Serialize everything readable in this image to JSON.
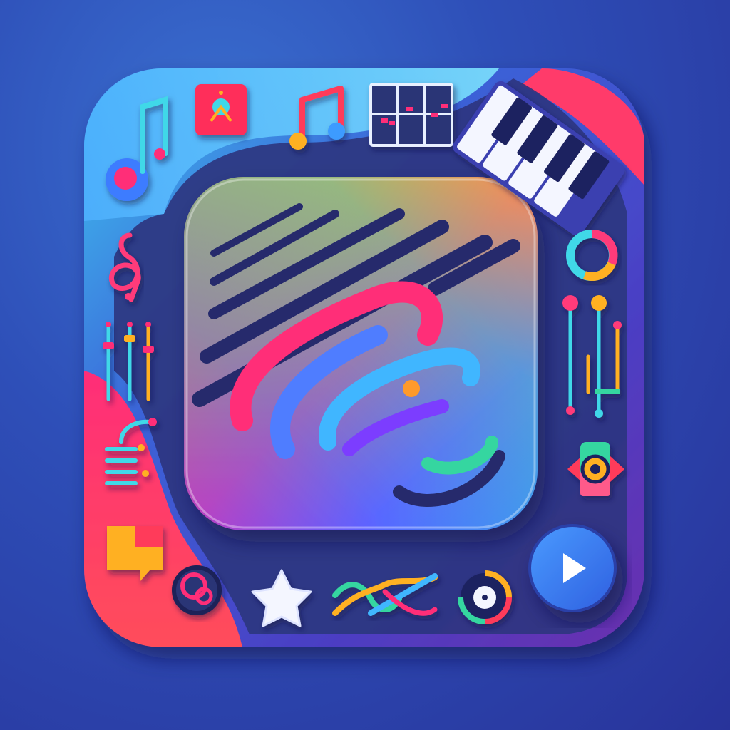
{
  "app_icon": {
    "description_name": "music-app-icon",
    "palette": {
      "background_top": "#3a6fd0",
      "background_bottom": "#28339a",
      "frame_dark": "#2a3476",
      "accent_pink": "#ff2d78",
      "accent_orange": "#ffb020",
      "accent_cyan": "#3fd8e8",
      "accent_blue": "#3d7bff",
      "accent_purple": "#7b3dff",
      "accent_green": "#36d6a0"
    },
    "icons": [
      "music-note-icon",
      "music-app-badge-icon",
      "beamed-notes-icon",
      "sequencer-grid-icon",
      "piano-keys-icon",
      "treble-clef-icon",
      "ring-chart-icon",
      "mixer-faders-icon",
      "equalizer-sliders-icon",
      "cable-coil-icon",
      "speaker-knob-icon",
      "tag-icon",
      "headphone-ring-icon",
      "star-icon",
      "waveform-cross-icon",
      "vinyl-disc-icon",
      "play-button-icon"
    ]
  }
}
